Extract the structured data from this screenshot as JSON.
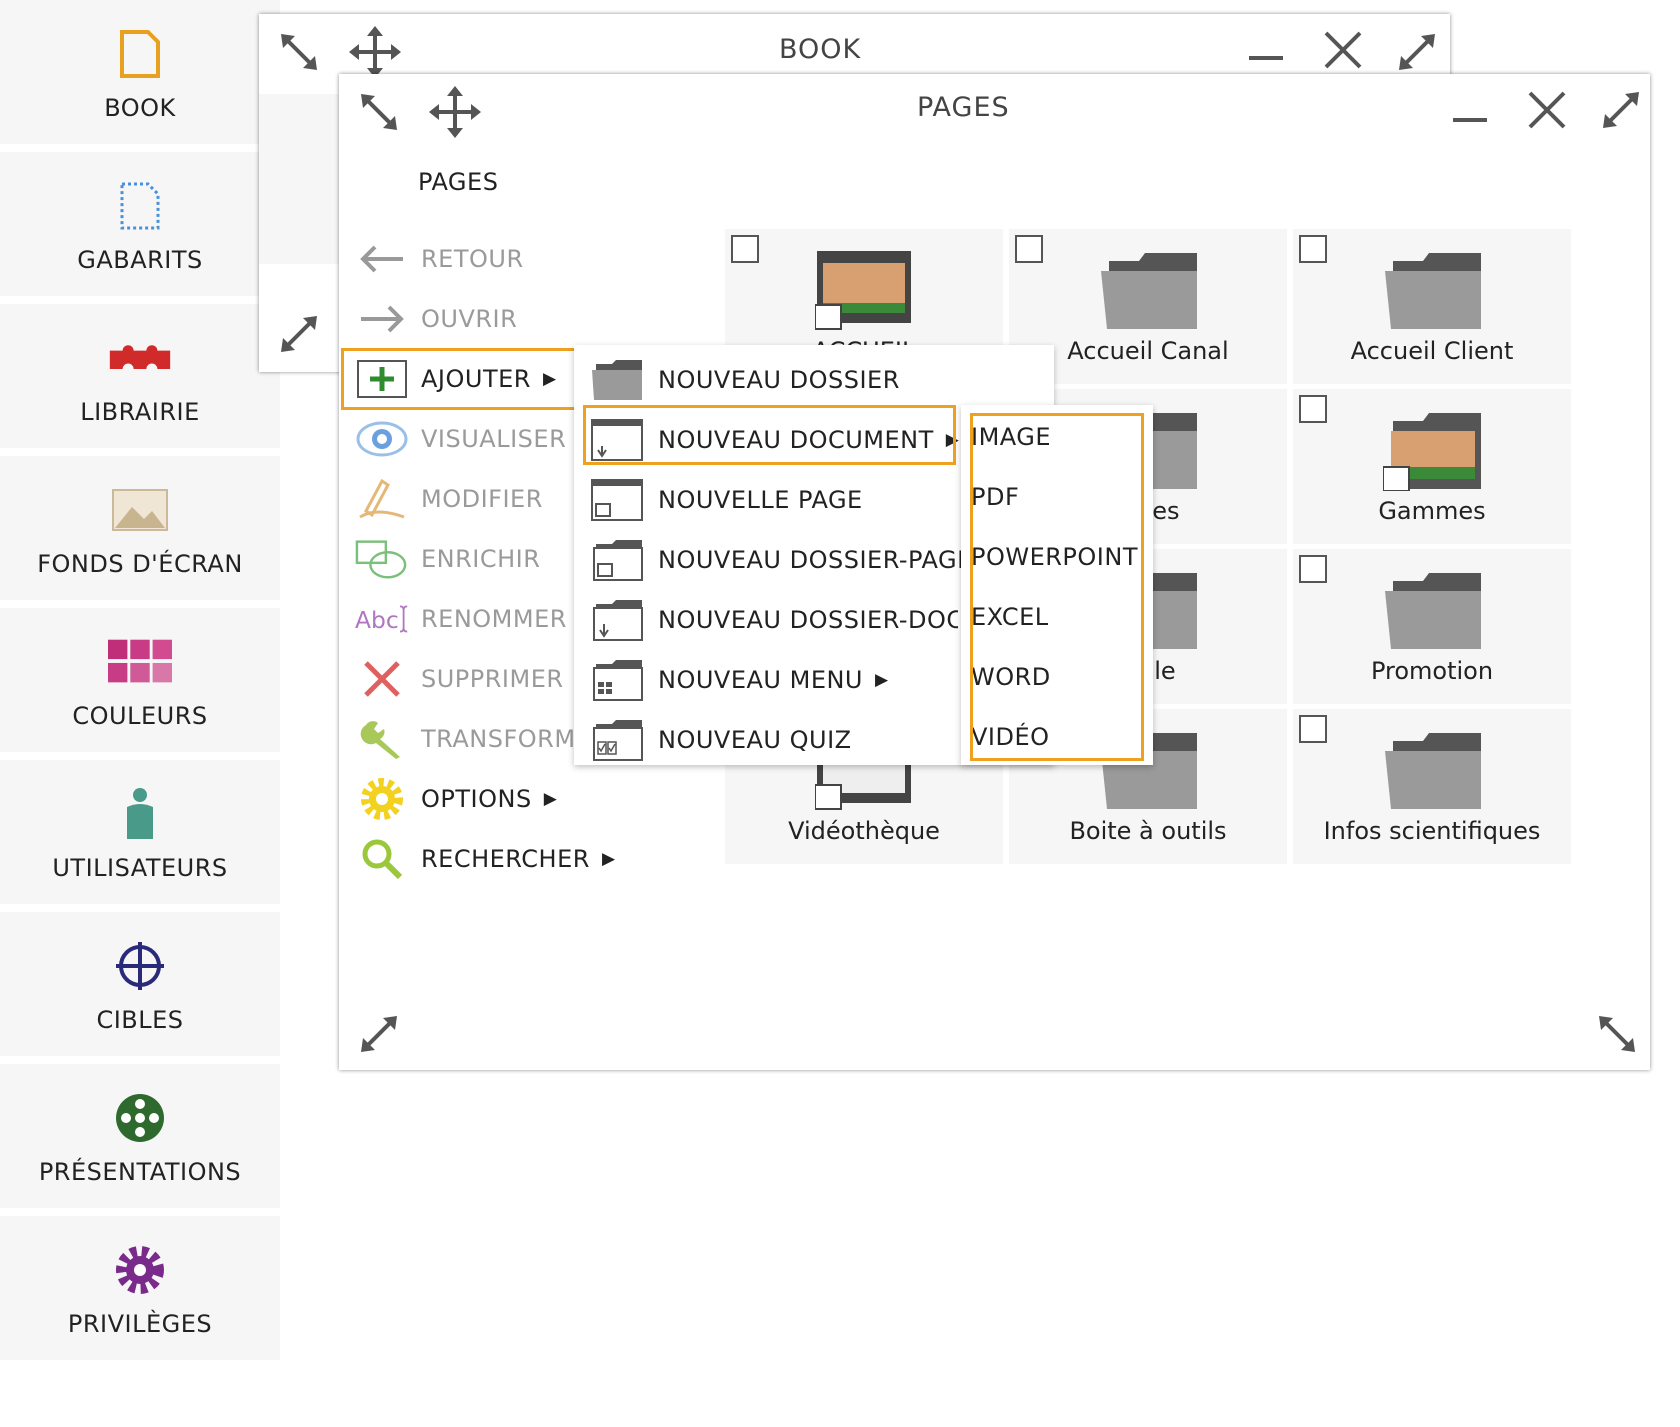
{
  "sidebar": {
    "items": [
      {
        "label": "BOOK",
        "icon": "book-icon"
      },
      {
        "label": "GABARITS",
        "icon": "template-icon"
      },
      {
        "label": "LIBRAIRIE",
        "icon": "puzzle-icon"
      },
      {
        "label": "FONDS D'ÉCRAN",
        "icon": "wallpaper-icon"
      },
      {
        "label": "COULEURS",
        "icon": "color-grid-icon"
      },
      {
        "label": "UTILISATEURS",
        "icon": "user-icon"
      },
      {
        "label": "CIBLES",
        "icon": "target-icon"
      },
      {
        "label": "PRÉSENTATIONS",
        "icon": "presentation-wheel-icon"
      },
      {
        "label": "PRIVILÈGES",
        "icon": "privileges-gear-icon"
      }
    ]
  },
  "book_window": {
    "title": "BOOK"
  },
  "pages_window": {
    "title": "PAGES",
    "heading": "PAGES",
    "actions": [
      {
        "label": "RETOUR",
        "icon": "arrow-left-icon"
      },
      {
        "label": "OUVRIR",
        "icon": "arrow-right-icon"
      },
      {
        "label": "AJOUTER",
        "icon": "plus-icon",
        "has_submenu": true
      },
      {
        "label": "VISUALISER",
        "icon": "eye-icon"
      },
      {
        "label": "MODIFIER",
        "icon": "pen-icon"
      },
      {
        "label": "ENRICHIR",
        "icon": "enrich-icon"
      },
      {
        "label": "RENOMMER",
        "icon": "rename-icon"
      },
      {
        "label": "SUPPRIMER",
        "icon": "delete-x-icon"
      },
      {
        "label": "TRANSFORM",
        "icon": "wrench-icon"
      },
      {
        "label": "OPTIONS",
        "icon": "options-gear-icon",
        "has_submenu": true
      },
      {
        "label": "RECHERCHER",
        "icon": "search-icon",
        "has_submenu": true
      }
    ],
    "tiles": [
      {
        "label": "ACCUEIL",
        "type": "page"
      },
      {
        "label": "Accueil Canal",
        "type": "folder"
      },
      {
        "label": "Accueil Client",
        "type": "folder"
      },
      {
        "label": "ces",
        "type": "folder"
      },
      {
        "label": "Gammes",
        "type": "page"
      },
      {
        "label": "ple",
        "type": "folder"
      },
      {
        "label": "Promotion",
        "type": "folder"
      },
      {
        "label": "Vidéothèque",
        "type": "page"
      },
      {
        "label": "Boite à outils",
        "type": "folder"
      },
      {
        "label": "Infos scientifiques",
        "type": "folder"
      }
    ]
  },
  "add_submenu": {
    "items": [
      {
        "label": "NOUVEAU DOSSIER",
        "icon": "folder-icon"
      },
      {
        "label": "NOUVEAU DOCUMENT",
        "icon": "document-download-icon",
        "has_submenu": true
      },
      {
        "label": "NOUVELLE PAGE",
        "icon": "page-icon"
      },
      {
        "label": "NOUVEAU DOSSIER-PAGE",
        "icon": "folder-page-icon"
      },
      {
        "label": "NOUVEAU DOSSIER-DOCU",
        "icon": "folder-document-icon"
      },
      {
        "label": "NOUVEAU MENU",
        "icon": "menu-icon",
        "has_submenu": true
      },
      {
        "label": "NOUVEAU QUIZ",
        "icon": "quiz-icon"
      }
    ]
  },
  "document_submenu": {
    "items": [
      "IMAGE",
      "PDF",
      "POWERPOINT",
      "EXCEL",
      "WORD",
      "VIDÉO"
    ]
  },
  "colors": {
    "highlight": "#f0a020",
    "tile_bg": "#f6f6f6",
    "sidebar_bg": "#f6f6f6"
  },
  "submenu_arrow": "▶"
}
